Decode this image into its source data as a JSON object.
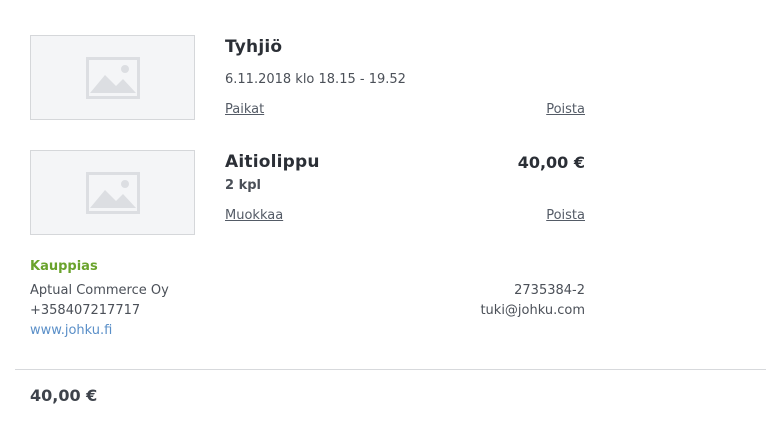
{
  "cart": {
    "items": [
      {
        "title": "Tyhjiö",
        "datetime": "6.11.2018 klo 18.15 - 19.52",
        "action_left": "Paikat",
        "action_right": "Poista",
        "thumbnail_icon": "image-placeholder-icon"
      },
      {
        "title": "Aitiolippu",
        "quantity": "2 kpl",
        "price": "40,00 €",
        "action_left": "Muokkaa",
        "action_right": "Poista",
        "thumbnail_icon": "image-placeholder-icon"
      }
    ]
  },
  "merchant": {
    "heading": "Kauppias",
    "name": "Aptual Commerce Oy",
    "phone": "+358407217717",
    "website": "www.johku.fi",
    "business_id": "2735384-2",
    "email": "tuki@johku.com"
  },
  "summary": {
    "total": "40,00 €"
  },
  "colors": {
    "merchant_heading": "#6aa32c",
    "link": "#5a8fc8",
    "text": "#33373d"
  }
}
